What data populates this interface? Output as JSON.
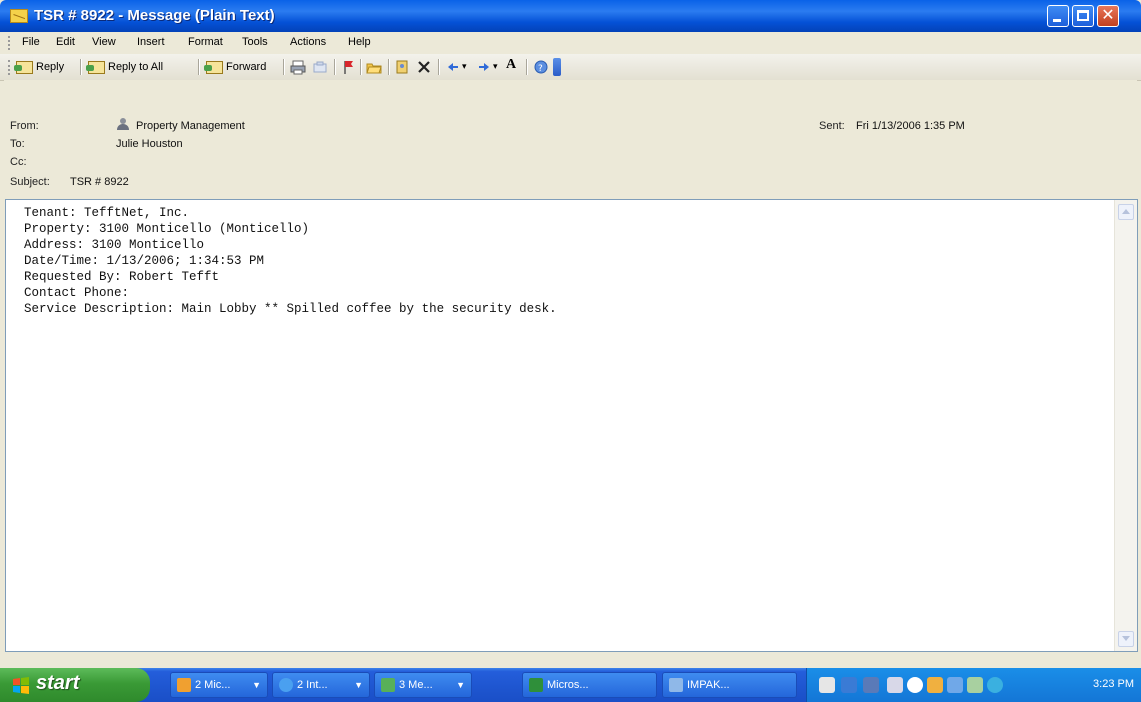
{
  "window": {
    "title": "TSR # 8922 - Message (Plain Text)"
  },
  "menu": [
    "File",
    "Edit",
    "View",
    "Insert",
    "Format",
    "Tools",
    "Actions",
    "Help"
  ],
  "toolbar": {
    "reply": "Reply",
    "reply_all": "Reply to All",
    "forward": "Forward",
    "font_size_icon": "A"
  },
  "header": {
    "from_label": "From:",
    "from_value": "Property Management",
    "to_label": "To:",
    "to_value": "Julie Houston",
    "cc_label": "Cc:",
    "cc_value": "",
    "subject_label": "Subject:",
    "subject_value": "TSR # 8922",
    "sent_label": "Sent:",
    "sent_value": "Fri 1/13/2006 1:35 PM"
  },
  "body": {
    "lines": [
      "Tenant: TefftNet, Inc.",
      "Property: 3100 Monticello (Monticello)",
      "Address: 3100 Monticello",
      "Date/Time: 1/13/2006; 1:34:53 PM",
      "Requested By: Robert Tefft",
      "Contact Phone:",
      "Service Description: Main Lobby ** Spilled coffee by the security desk."
    ]
  },
  "taskbar": {
    "start": "start",
    "tasks": [
      {
        "label": "2 Mic...",
        "icon": "office-icon",
        "color": "#f0a030"
      },
      {
        "label": "2 Int...",
        "icon": "ie-icon",
        "color": "#4aa0f0"
      },
      {
        "label": "3 Me...",
        "icon": "messenger-icon",
        "color": "#58b058"
      },
      {
        "label": "Micros...",
        "icon": "excel-icon",
        "color": "#2f8f3a"
      },
      {
        "label": "IMPAK...",
        "icon": "app-icon",
        "color": "#8fb8e8"
      }
    ],
    "clock": "3:23 PM"
  },
  "colors": {
    "title_bar": "#0a62e8",
    "taskbar": "#245edb",
    "start_button": "#3a9a36",
    "chrome": "#ece9d8"
  }
}
